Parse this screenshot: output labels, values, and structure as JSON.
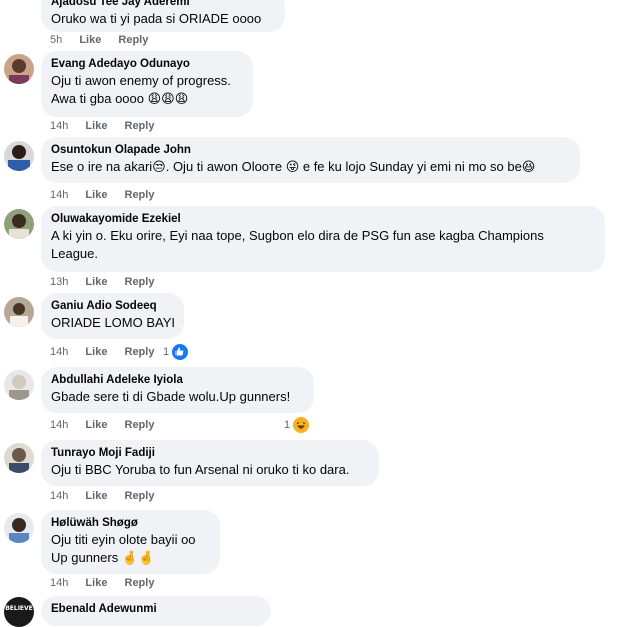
{
  "comments": [
    {
      "author": "Ajadosu Tee Jay Aderemi",
      "lines": [
        "Oruko wa ti yi pada si ORIADE oooo"
      ],
      "time": "5h",
      "like": "Like",
      "reply": "Reply"
    },
    {
      "author": "Evang Adedayo Odunayo",
      "lines": [
        "Oju ti awon enemy of progress.",
        "Awa ti gba oooo 😩😩😩"
      ],
      "time": "14h",
      "like": "Like",
      "reply": "Reply"
    },
    {
      "author": "Osuntokun Olapade John",
      "lines": [
        "Ese o ire na akari😒. Oju ti awon Olooте 😜 e fe ku lojo Sunday yi emi ni mo so be😆"
      ],
      "time": "14h",
      "like": "Like",
      "reply": "Reply"
    },
    {
      "author": "Oluwakayomide Ezekiel",
      "lines": [
        "A ki yin o. Eku orire, Eyi naa tope, Sugbon elo dira de PSG fun ase kagba Champions",
        "League."
      ],
      "time": "13h",
      "like": "Like",
      "reply": "Reply"
    },
    {
      "author": "Ganiu Adio Sodeeq",
      "lines": [
        "ORIADE LOMO BAYI"
      ],
      "time": "14h",
      "like": "Like",
      "reply": "Reply",
      "reaction_count": "1"
    },
    {
      "author": "Abdullahi Adeleke Iyiola",
      "lines": [
        "Gbade sere ti di Gbade wolu.Up gunners!"
      ],
      "time": "14h",
      "like": "Like",
      "reply": "Reply",
      "reaction_count": "1"
    },
    {
      "author": "Tunrayo Moji Fadiji",
      "lines": [
        "Oju ti BBC Yoruba to fun Arsenal ni oruko ti ko dara."
      ],
      "time": "14h",
      "like": "Like",
      "reply": "Reply"
    },
    {
      "author": "Hølüwäh Shøgø",
      "lines": [
        "Oju titi eyin olote bayii oo",
        "Up gunners 🤞🤞"
      ],
      "time": "14h",
      "like": "Like",
      "reply": "Reply"
    },
    {
      "author": "Ebenald Adewunmi",
      "lines": [],
      "time": "",
      "like": "",
      "reply": ""
    }
  ],
  "colors": {
    "bubble": "#f0f2f5",
    "meta": "#65676b",
    "like_blue": "#1877f2"
  },
  "icons": {
    "like": "thumbs-up-icon",
    "haha": "laughing-emoji-icon"
  },
  "avatar_badge_text": "BELIEVE"
}
